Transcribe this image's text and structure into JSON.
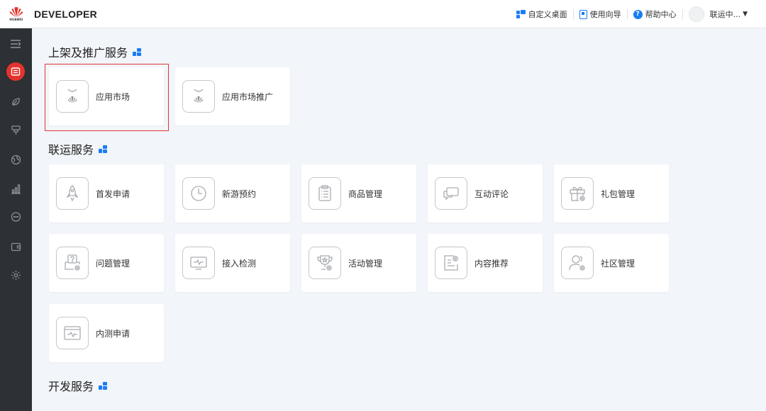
{
  "header": {
    "logo_text": "HUAWEI",
    "brand": "DEVELOPER",
    "custom_desktop": "自定义桌面",
    "user_guide": "使用向导",
    "help_center": "帮助中心",
    "help_glyph": "?",
    "username": "联运中...",
    "caret": "▼"
  },
  "sidebar": {
    "items": [
      {
        "name": "menu-toggle-icon"
      },
      {
        "name": "store-icon",
        "active": true
      },
      {
        "name": "leaf-icon"
      },
      {
        "name": "brush-icon"
      },
      {
        "name": "globe-icon"
      },
      {
        "name": "chart-icon"
      },
      {
        "name": "chat-icon"
      },
      {
        "name": "wallet-icon"
      },
      {
        "name": "settings-icon"
      }
    ]
  },
  "sections": [
    {
      "title": "上架及推广服务",
      "cards": [
        {
          "label": "应用市场",
          "icon": "huawei-bag-icon",
          "selected": true
        },
        {
          "label": "应用市场推广",
          "icon": "huawei-bag-icon"
        }
      ]
    },
    {
      "title": "联运服务",
      "cards": [
        {
          "label": "首发申请",
          "icon": "rocket-icon"
        },
        {
          "label": "新游预约",
          "icon": "clock-icon"
        },
        {
          "label": "商品管理",
          "icon": "clipboard-icon"
        },
        {
          "label": "互动评论",
          "icon": "comment-icon"
        },
        {
          "label": "礼包管理",
          "icon": "gift-icon"
        },
        {
          "label": "问题管理",
          "icon": "question-icon"
        },
        {
          "label": "接入检测",
          "icon": "monitor-icon"
        },
        {
          "label": "活动管理",
          "icon": "trophy-icon"
        },
        {
          "label": "内容推荐",
          "icon": "document-gear-icon"
        },
        {
          "label": "社区管理",
          "icon": "community-icon"
        },
        {
          "label": "内测申请",
          "icon": "browser-pulse-icon"
        }
      ]
    },
    {
      "title": "开发服务",
      "cards": []
    }
  ],
  "colors": {
    "accent": "#1a7cf4",
    "brand_red": "#e5322d",
    "sidebar_bg": "#2d3034",
    "page_bg": "#f2f5f9",
    "icon_stroke": "#a9acb1"
  }
}
